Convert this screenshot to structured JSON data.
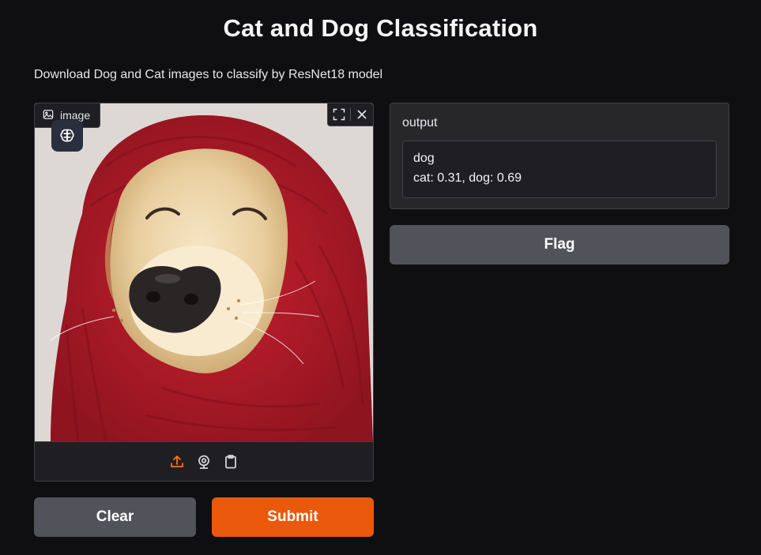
{
  "app": {
    "title": "Cat and Dog Classification",
    "description": "Download Dog and Cat images to classify by ResNet18 model"
  },
  "input": {
    "label": "image",
    "image_subject": "golden retriever in red knit hood"
  },
  "output": {
    "label": "output",
    "predicted_class": "dog",
    "probabilities_text": "cat: 0.31, dog: 0.69"
  },
  "buttons": {
    "clear": "Clear",
    "submit": "Submit",
    "flag": "Flag"
  },
  "icons": {
    "image_label": "image-icon",
    "model_badge": "brain-icon",
    "fullscreen": "fullscreen-icon",
    "close": "close-icon",
    "upload": "upload-icon",
    "webcam": "webcam-icon",
    "clipboard": "clipboard-icon"
  },
  "colors": {
    "background": "#0f0f11",
    "panel": "#27272a",
    "primary": "#ea580c",
    "secondary": "#52525b",
    "upload_accent": "#f97316"
  }
}
